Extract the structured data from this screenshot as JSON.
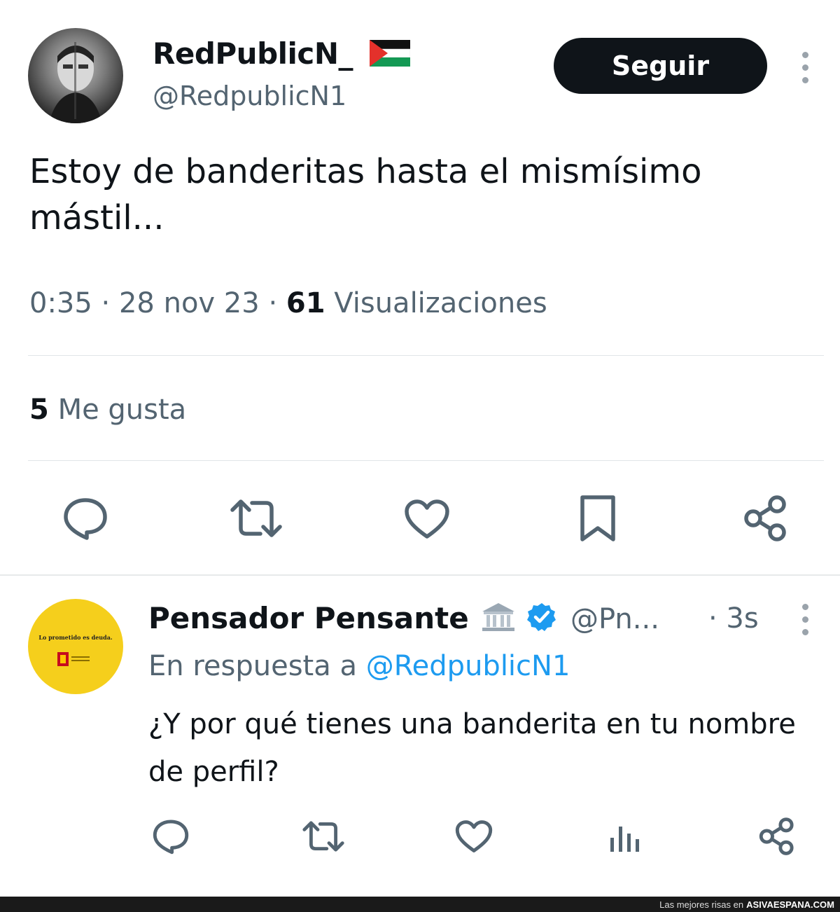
{
  "tweet": {
    "display_name": "RedPublicN_",
    "flag_emoji": "🇵🇸",
    "handle": "@RedpublicN1",
    "follow_label": "Seguir",
    "text": "Estoy de banderitas hasta el mismísimo mástil...",
    "time": "0:35",
    "date": "28 nov 23",
    "views_count": "61",
    "views_label": "Visualizaciones",
    "likes_count": "5",
    "likes_label": "Me gusta",
    "separator": "·",
    "actions": [
      "reply-icon",
      "retweet-icon",
      "like-icon",
      "bookmark-icon",
      "share-icon"
    ]
  },
  "reply": {
    "display_name": "Pensador Pensante",
    "badge_emoji": "🏛️",
    "handle": "@Pn...",
    "age": "· 3s",
    "reply_prefix": "En respuesta a",
    "reply_to": "@RedpublicN1",
    "text": "¿Y por qué tienes una banderita en tu nombre de perfil?",
    "avatar_text": "Lo prometido es deuda.",
    "actions": [
      "reply-icon",
      "retweet-icon",
      "like-icon",
      "views-icon",
      "share-icon"
    ]
  },
  "footer": {
    "prefix": "Las mejores risas en",
    "site": "ASIVAESPANA.COM"
  },
  "colors": {
    "text": "#0f1419",
    "secondary": "#536471",
    "link": "#1d9bf0",
    "verified": "#1d9bf0",
    "follow_bg": "#0f1419",
    "divider": "#e1e5e8",
    "reply_avatar_bg": "#f5cf1c"
  }
}
